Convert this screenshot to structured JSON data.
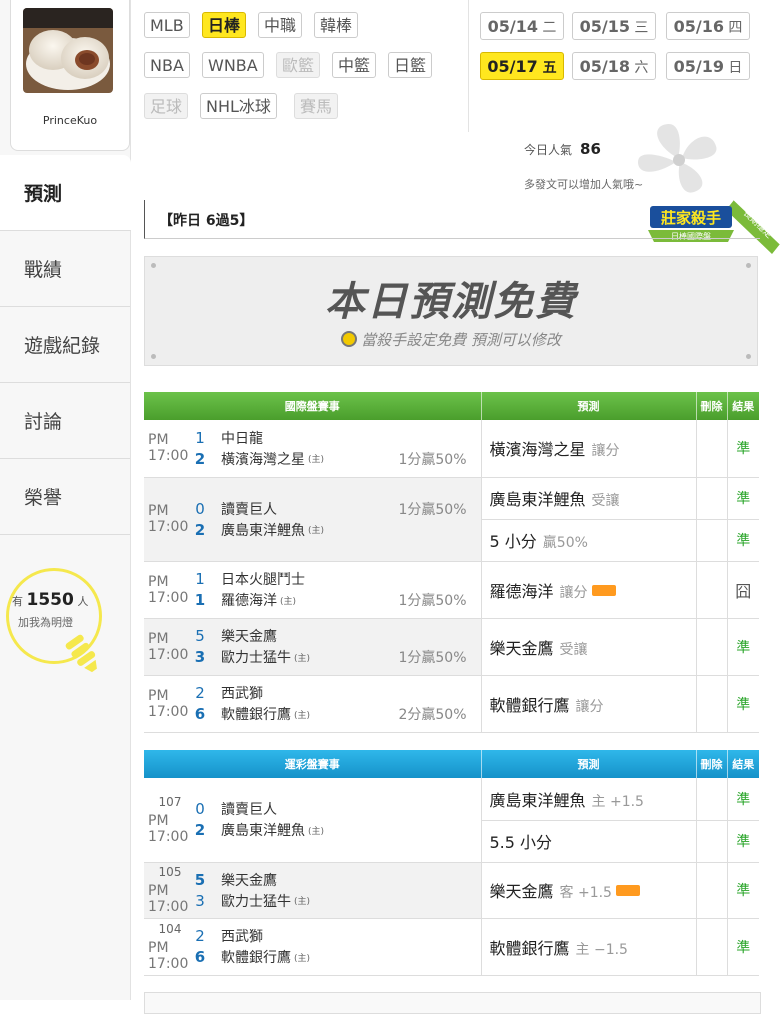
{
  "user": {
    "name": "PrinceKuo"
  },
  "nav": [
    "預測",
    "戰績",
    "遊戲紀錄",
    "討論",
    "榮譽"
  ],
  "fans": {
    "prefix": "有",
    "count": "1550",
    "suffix": "人",
    "sub": "加我為明燈"
  },
  "sports": [
    "MLB",
    "日棒",
    "中職",
    "韓棒",
    "NBA",
    "WNBA",
    "歐籃",
    "中籃",
    "日籃",
    "足球",
    "NHL冰球",
    "賽馬"
  ],
  "dates": [
    {
      "md": "05/14",
      "wd": "二"
    },
    {
      "md": "05/15",
      "wd": "三"
    },
    {
      "md": "05/16",
      "wd": "四"
    },
    {
      "md": "05/17",
      "wd": "五"
    },
    {
      "md": "05/18",
      "wd": "六"
    },
    {
      "md": "05/19",
      "wd": "日"
    }
  ],
  "popularity": {
    "label": "今日人氣",
    "value": "86",
    "tip": "多發文可以增加人氣哦~"
  },
  "badge": {
    "main": "莊家殺手",
    "sub": "日棒國際盤",
    "ribbon": "長期穩定"
  },
  "record": "【昨日 6過5】",
  "banner": {
    "title": "本日預測免費",
    "subtitle": "當殺手設定免費 預測可以修改"
  },
  "intl": {
    "headers": {
      "game": "國際盤賽事",
      "pred": "預測",
      "del": "刪除",
      "res": "結果"
    },
    "games": [
      {
        "time": "PM 17:00",
        "away": {
          "score": "1",
          "name": "中日龍"
        },
        "home": {
          "score": "2",
          "name": "橫濱海灣之星"
        },
        "odds": "1分贏50%",
        "picks": [
          {
            "pick": "橫濱海灣之星",
            "type": "讓分",
            "result": "準"
          }
        ]
      },
      {
        "time": "PM 17:00",
        "away": {
          "score": "0",
          "name": "讀賣巨人"
        },
        "home": {
          "score": "2",
          "name": "廣島東洋鯉魚"
        },
        "odds": "1分贏50%",
        "picks": [
          {
            "pick": "廣島東洋鯉魚",
            "type": "受讓",
            "result": "準"
          },
          {
            "pick": "5 小分",
            "type": "贏50%",
            "result": "準"
          }
        ]
      },
      {
        "time": "PM 17:00",
        "away": {
          "score": "1",
          "name": "日本火腿鬥士"
        },
        "home": {
          "score": "1",
          "name": "羅德海洋"
        },
        "odds": "1分贏50%",
        "picks": [
          {
            "pick": "羅德海洋",
            "type": "讓分",
            "result": "囧"
          }
        ]
      },
      {
        "time": "PM 17:00",
        "away": {
          "score": "5",
          "name": "樂天金鷹"
        },
        "home": {
          "score": "3",
          "name": "歐力士猛牛"
        },
        "odds": "1分贏50%",
        "picks": [
          {
            "pick": "樂天金鷹",
            "type": "受讓",
            "result": "準"
          }
        ]
      },
      {
        "time": "PM 17:00",
        "away": {
          "score": "2",
          "name": "西武獅"
        },
        "home": {
          "score": "6",
          "name": "軟體銀行鷹"
        },
        "odds": "2分贏50%",
        "picks": [
          {
            "pick": "軟體銀行鷹",
            "type": "讓分",
            "result": "準"
          }
        ]
      }
    ]
  },
  "lottery": {
    "headers": {
      "game": "運彩盤賽事",
      "pred": "預測",
      "del": "刪除",
      "res": "結果"
    },
    "games": [
      {
        "num": "107",
        "time": "PM 17:00",
        "away": {
          "score": "0",
          "name": "讀賣巨人"
        },
        "home": {
          "score": "2",
          "name": "廣島東洋鯉魚"
        },
        "picks": [
          {
            "pick": "廣島東洋鯉魚",
            "type": "主 +1.5",
            "result": "準"
          },
          {
            "pick": "5.5 小分",
            "type": "",
            "result": "準"
          }
        ]
      },
      {
        "num": "105",
        "time": "PM 17:00",
        "away": {
          "score": "5",
          "name": "樂天金鷹"
        },
        "home": {
          "score": "3",
          "name": "歐力士猛牛"
        },
        "picks": [
          {
            "pick": "樂天金鷹",
            "type": "客 +1.5",
            "result": "準"
          }
        ]
      },
      {
        "num": "104",
        "time": "PM 17:00",
        "away": {
          "score": "2",
          "name": "西武獅"
        },
        "home": {
          "score": "6",
          "name": "軟體銀行鷹"
        },
        "picks": [
          {
            "pick": "軟體銀行鷹",
            "type": "主 −1.5",
            "result": "準"
          }
        ]
      }
    ]
  },
  "home_mark": "(主)"
}
